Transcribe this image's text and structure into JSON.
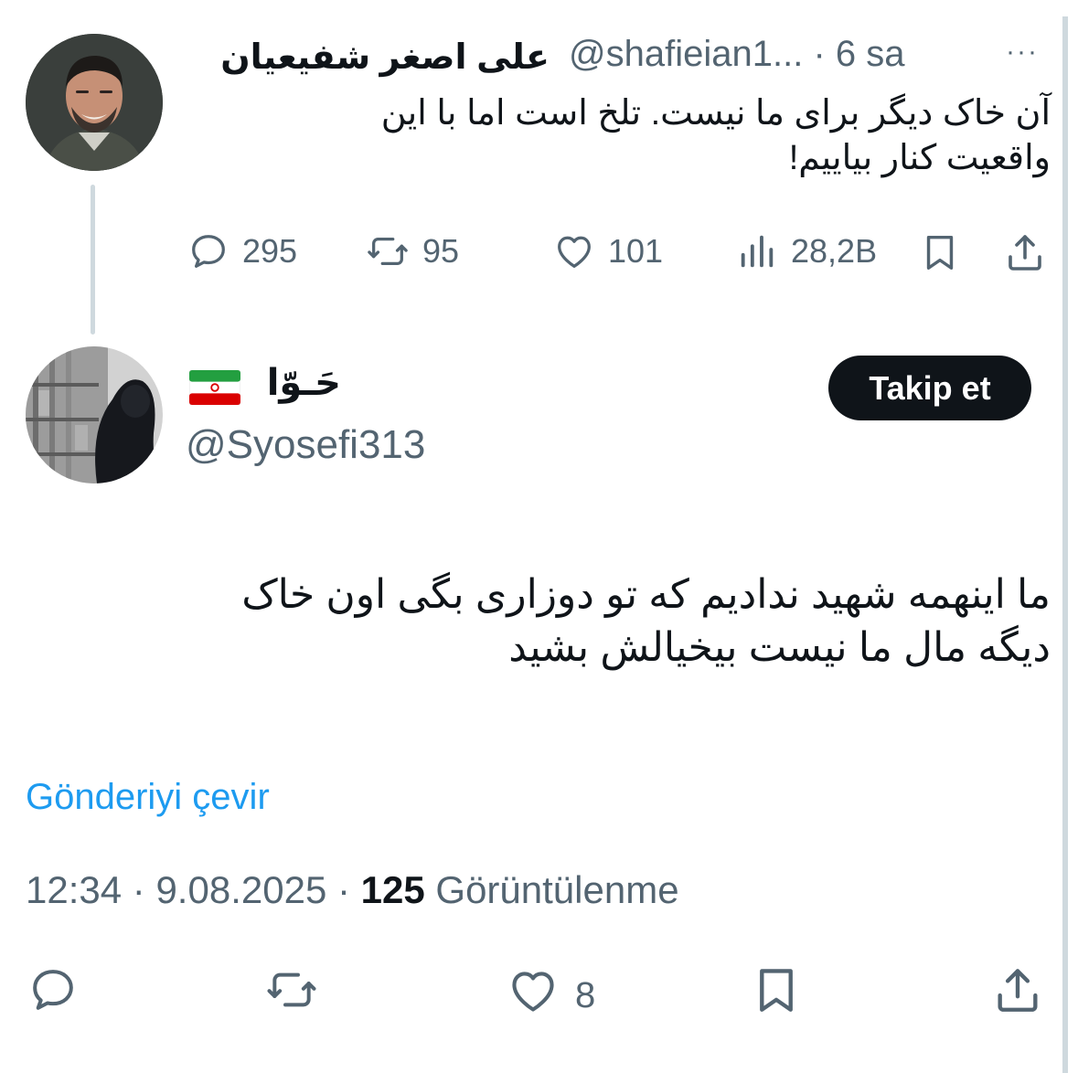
{
  "parent_tweet": {
    "display_name": "علی اصغر شفیعیان",
    "handle": "@shafieian1...",
    "separator": "·",
    "time": "6 sa",
    "more": "···",
    "text_line1": "آن خاک دیگر برای ما نیست. تلخ است اما با این",
    "text_line2": "واقعیت کنار بیاییم!",
    "stats": {
      "replies": "295",
      "reposts": "95",
      "likes": "101",
      "views": "28,2B"
    }
  },
  "main_tweet": {
    "display_name": "حَـوّا",
    "flag_emoji": "🇮🇷",
    "handle": "@Syosefi313",
    "follow_label": "Takip et",
    "text_line1": "ما اینهمه شهید ندادیم که تو دوزاری بگی اون خاک",
    "text_line2": "دیگه مال ما نیست بیخیالش بشید",
    "translate_label": "Gönderiyi çevir",
    "time": "12:34",
    "date": "9.08.2025",
    "dot": "·",
    "views_count": "125",
    "views_label": "Görüntülenme",
    "likes": "8"
  },
  "colors": {
    "text": "#0f1419",
    "muted": "#536471",
    "link": "#1d9bf0",
    "thread_line": "#cfd9de",
    "button_bg": "#0f1419",
    "flag_green": "#239f40",
    "flag_red": "#da0000"
  },
  "icons": [
    "reply-icon",
    "repost-icon",
    "like-icon",
    "views-icon",
    "bookmark-icon",
    "share-icon",
    "more-icon"
  ]
}
